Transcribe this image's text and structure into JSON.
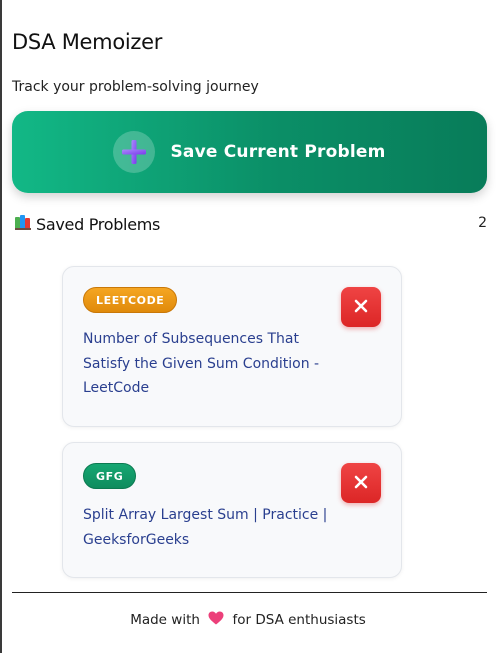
{
  "header": {
    "title": "DSA Memoizer",
    "subtitle": "Track your problem-solving journey"
  },
  "save_button": {
    "label": "Save Current Problem",
    "icon": "plus-icon"
  },
  "saved_section": {
    "label": "Saved Problems",
    "icon": "books-icon",
    "count": "2"
  },
  "problems": [
    {
      "platform": "LEETCODE",
      "title": "Number of Subsequences That Satisfy the Given Sum Condition - LeetCode",
      "delete_icon": "close-icon"
    },
    {
      "platform": "GFG",
      "title": "Split Array Largest Sum | Practice | GeeksforGeeks",
      "delete_icon": "close-icon"
    }
  ],
  "footer": {
    "prefix": "Made with",
    "suffix": "for DSA enthusiasts",
    "icon": "heart-icon"
  },
  "colors": {
    "primary_gradient_start": "#12b886",
    "primary_gradient_end": "#087c59",
    "leetcode_badge": "#f0a020",
    "gfg_badge": "#139966",
    "delete": "#e53e3e",
    "link": "#2a3f8f"
  }
}
